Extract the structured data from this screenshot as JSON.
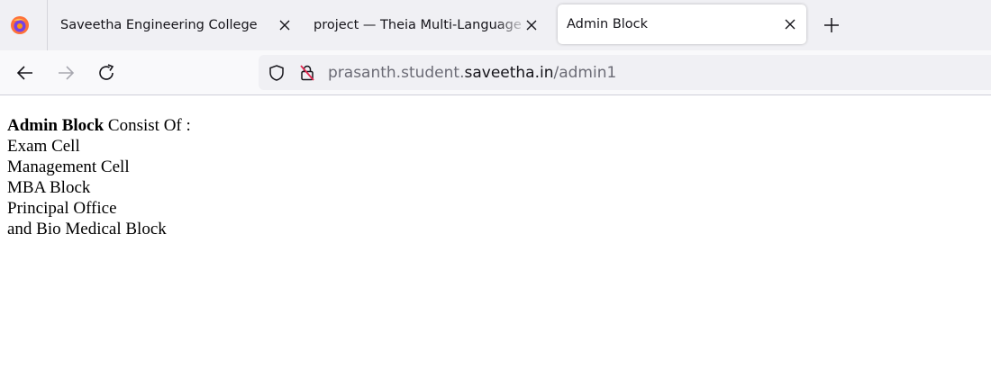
{
  "browser": {
    "tabs": [
      {
        "title": "Saveetha Engineering College",
        "active": false
      },
      {
        "title": "project — Theia Multi-Language Explorer",
        "active": false
      },
      {
        "title": "Admin Block",
        "active": true
      }
    ],
    "url": {
      "prefix": "prasanth.student.",
      "host": "saveetha.in",
      "path": "/admin1"
    }
  },
  "page": {
    "heading_bold": "Admin Block",
    "heading_rest": " Consist Of :",
    "items": [
      "Exam Cell",
      "Management Cell",
      "MBA Block",
      "Principal Office",
      "and Bio Medical Block"
    ]
  }
}
